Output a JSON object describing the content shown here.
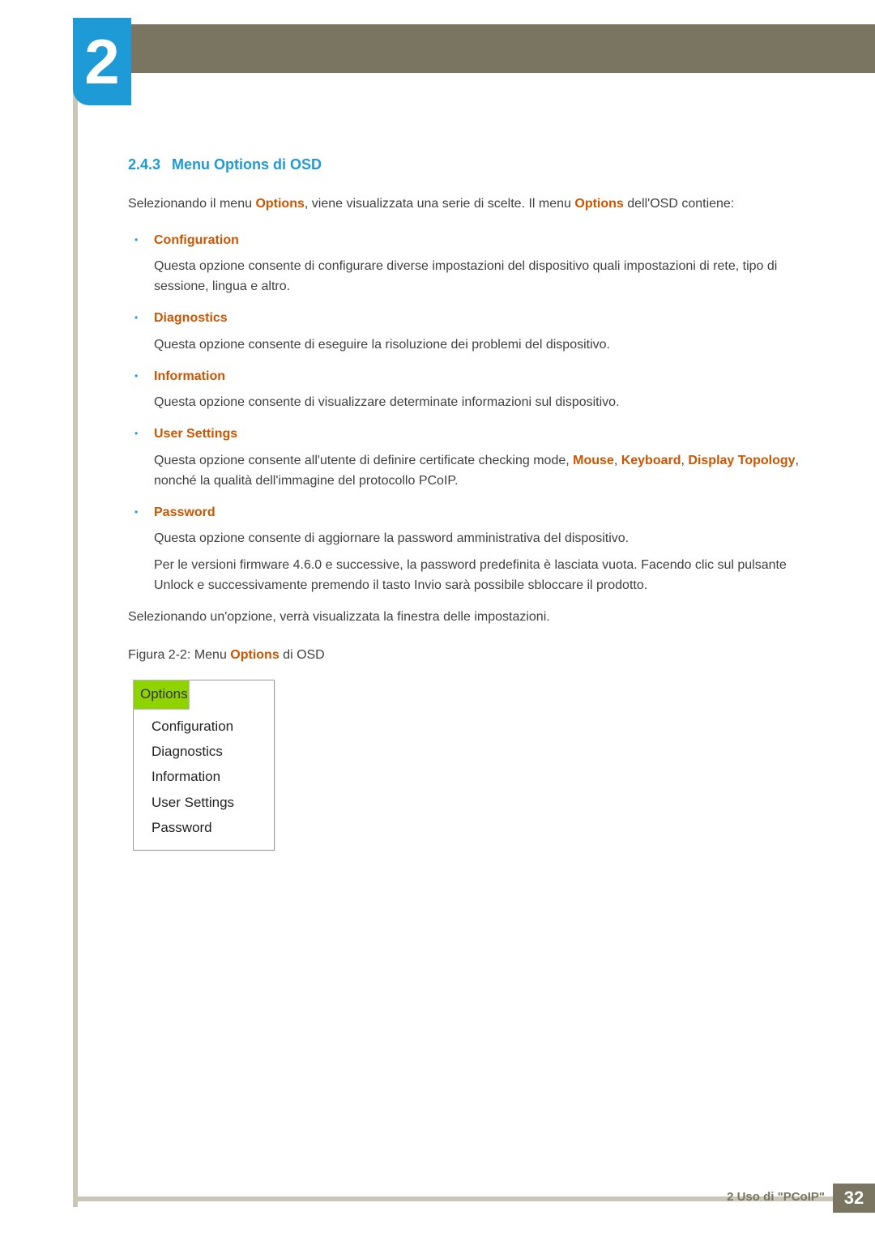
{
  "header": {
    "chapter_number": "2",
    "chapter_title": "Uso di \"PCoIP\""
  },
  "section": {
    "number": "2.4.3",
    "title": "Menu Options di OSD"
  },
  "intro": {
    "pre": "Selezionando il menu ",
    "options1": "Options",
    "mid": ", viene visualizzata una serie di scelte. Il menu ",
    "options2": "Options",
    "post": " dell'OSD contiene:"
  },
  "bullets": [
    {
      "title": "Configuration",
      "desc": "Questa opzione consente di configurare diverse impostazioni del dispositivo quali impostazioni di rete, tipo di sessione, lingua e altro."
    },
    {
      "title": "Diagnostics",
      "desc": "Questa opzione consente di eseguire la risoluzione dei problemi del dispositivo."
    },
    {
      "title": "Information",
      "desc": "Questa opzione consente di visualizzare determinate informazioni sul dispositivo."
    },
    {
      "title": "User Settings",
      "desc_pre": "Questa opzione consente all'utente di definire certificate checking mode, ",
      "mouse": "Mouse",
      "sep1": ", ",
      "keyboard": "Keyboard",
      "sep2": ", ",
      "display_topology": "Display Topology",
      "desc_post": ", nonché la qualità dell'immagine del protocollo PCoIP."
    },
    {
      "title": "Password",
      "desc": "Questa opzione consente di aggiornare la password amministrativa del dispositivo.",
      "desc2": "Per le versioni firmware 4.6.0 e successive, la password predefinita è lasciata vuota. Facendo clic sul pulsante Unlock e successivamente premendo il tasto Invio sarà possibile sbloccare il prodotto."
    }
  ],
  "after_list": "Selezionando un'opzione, verrà visualizzata la finestra delle impostazioni.",
  "figure": {
    "caption_pre": "Figura 2-2: Menu ",
    "caption_orange": "Options",
    "caption_post": " di OSD",
    "menu_header": "Options",
    "menu_items": [
      "Configuration",
      "Diagnostics",
      "Information",
      "User Settings",
      "Password"
    ]
  },
  "footer": {
    "label": "2 Uso di \"PCoIP\"",
    "page": "32"
  }
}
